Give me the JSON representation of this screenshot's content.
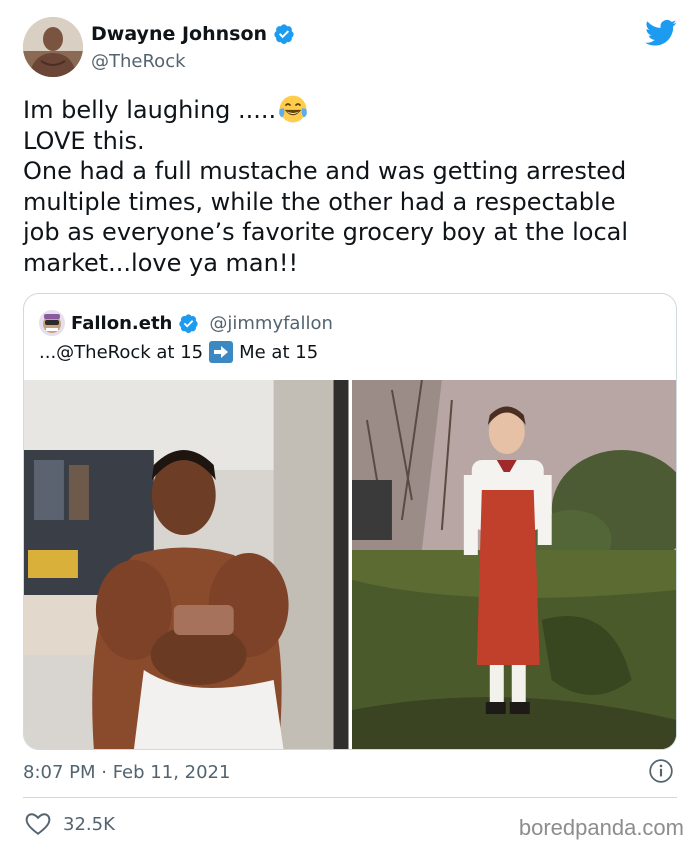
{
  "author": {
    "name": "Dwayne Johnson",
    "handle": "@TheRock",
    "verified": true
  },
  "tweet": {
    "lines": [
      "Im belly laughing .....",
      "LOVE this.",
      "One had a full mustache and was getting arrested",
      "multiple times, while the other had a respectable",
      "job as everyone’s favorite grocery boy at the local",
      "market...love ya man!!"
    ],
    "emoji": "face-with-tears-of-joy-icon"
  },
  "quoted_tweet": {
    "name": "Fallon.eth",
    "handle": "@jimmyfallon",
    "verified": true,
    "text_before": "...@TheRock at 15",
    "arrow_icon": "right-arrow-icon",
    "text_after": "Me at 15"
  },
  "meta": {
    "timestamp": "8:07 PM · Feb 11, 2021",
    "likes": "32.5K"
  },
  "watermark": "boredpanda.com",
  "colors": {
    "accent": "#1d9bf0",
    "secondary_text": "#536471",
    "border": "#cfd9de"
  }
}
